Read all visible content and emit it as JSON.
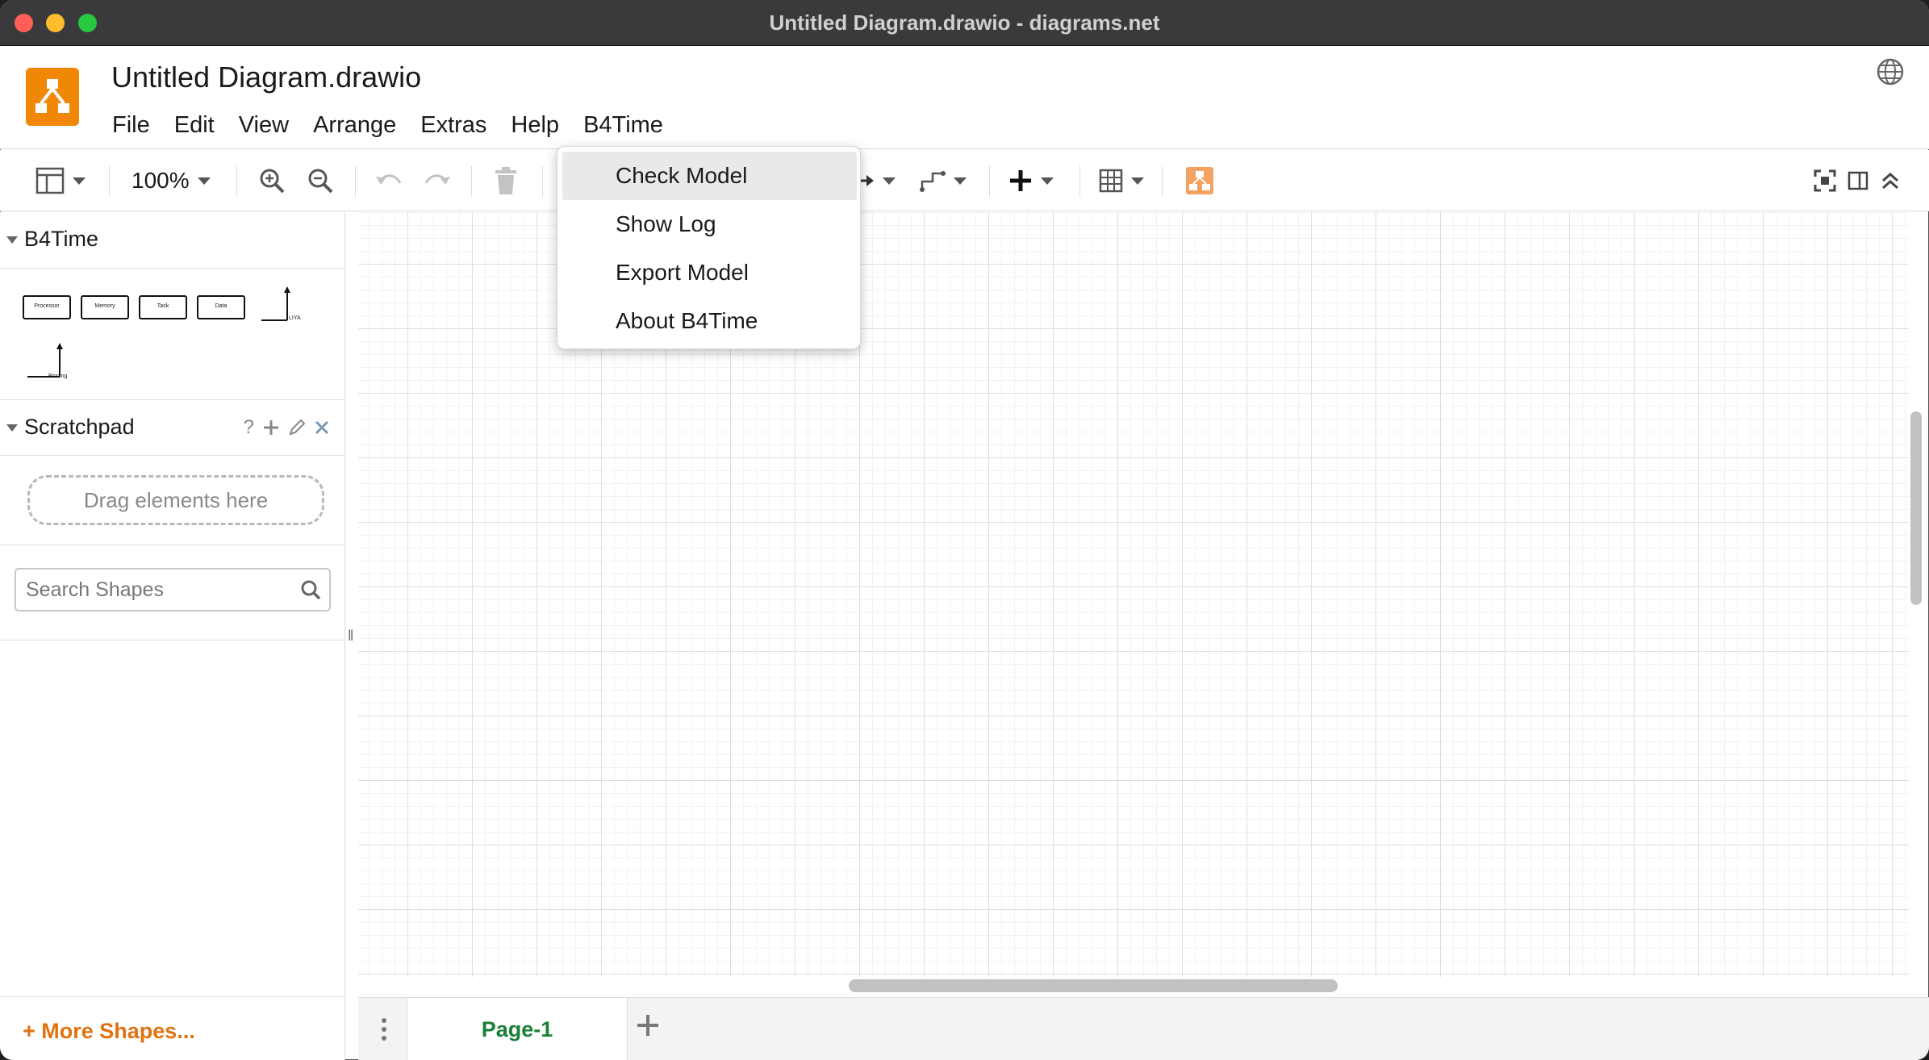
{
  "window": {
    "title": "Untitled Diagram.drawio - diagrams.net"
  },
  "header": {
    "doc_title": "Untitled Diagram.drawio",
    "menu": [
      "File",
      "Edit",
      "View",
      "Arrange",
      "Extras",
      "Help",
      "B4Time"
    ]
  },
  "toolbar": {
    "zoom": "100%"
  },
  "sidebar": {
    "b4time_section": "B4Time",
    "shapes": [
      "Processor",
      "Memory",
      "Task",
      "Data",
      "LIYA",
      "Binding"
    ],
    "scratchpad_section": "Scratchpad",
    "scratchpad_help": "?",
    "drag_hint": "Drag elements here",
    "search_placeholder": "Search Shapes",
    "more_shapes": "+ More Shapes..."
  },
  "pages": {
    "tabs": [
      "Page-1"
    ],
    "active": "Page-1"
  },
  "dropdown": {
    "items": [
      "Check Model",
      "Show Log",
      "Export Model",
      "About B4Time"
    ],
    "highlighted": "Check Model"
  },
  "colors": {
    "accent_orange": "#f08705",
    "page_tab_green": "#1a7f37",
    "more_shapes_orange": "#e0720f"
  }
}
